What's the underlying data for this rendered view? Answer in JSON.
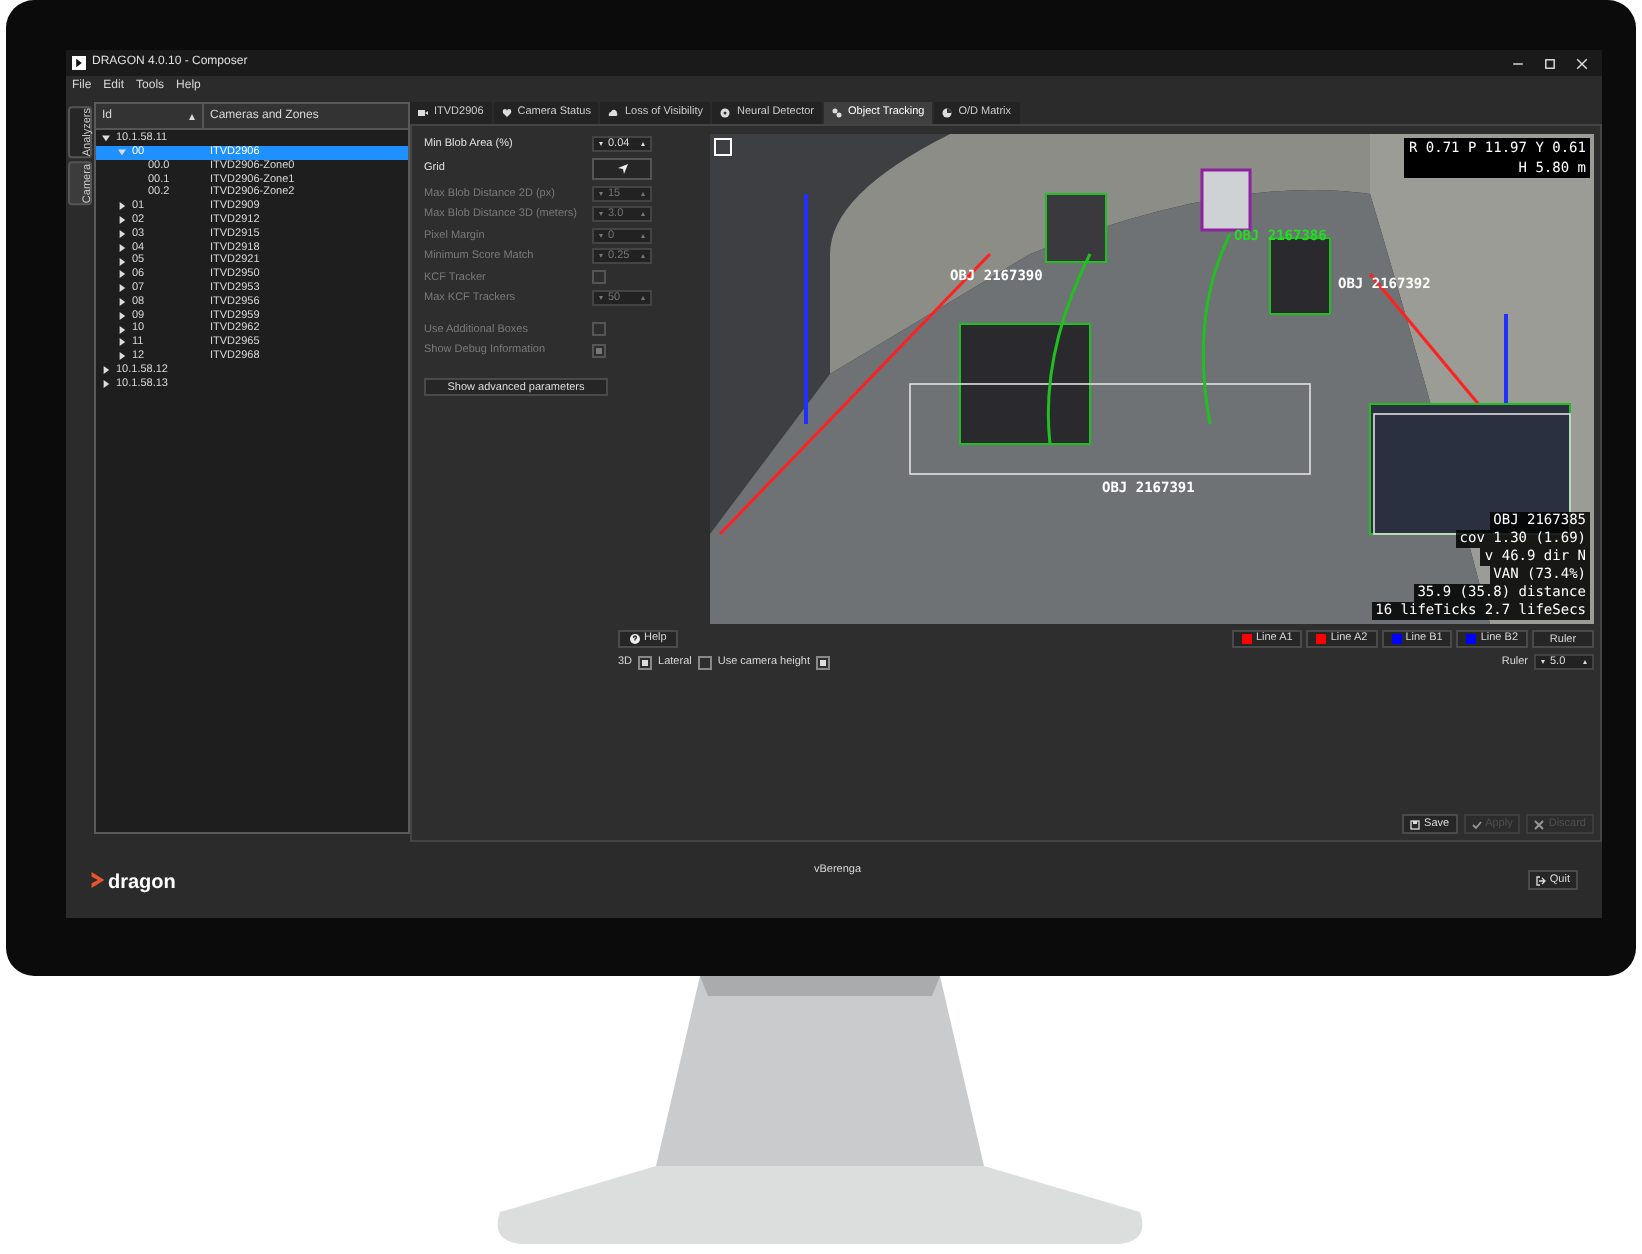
{
  "window": {
    "title": "DRAGON 4.0.10 - Composer"
  },
  "menu": [
    "File",
    "Edit",
    "Tools",
    "Help"
  ],
  "side_tabs": [
    {
      "label": "Analyzers",
      "selected": false
    },
    {
      "label": "Camera",
      "selected": true
    }
  ],
  "tree": {
    "columns": [
      "Id",
      "Cameras and Zones"
    ],
    "items": [
      {
        "id": "10.1.58.11",
        "expanded": true,
        "selected": false,
        "children": [
          {
            "id": "00",
            "name": "ITVD2906",
            "expanded": true,
            "selected": true,
            "children": [
              {
                "id": "00.0",
                "name": "ITVD2906-Zone0",
                "selected": false
              },
              {
                "id": "00.1",
                "name": "ITVD2906-Zone1",
                "selected": false
              },
              {
                "id": "00.2",
                "name": "ITVD2906-Zone2",
                "selected": false
              }
            ]
          },
          {
            "id": "01",
            "name": "ITVD2909",
            "expanded": false,
            "selected": false
          },
          {
            "id": "02",
            "name": "ITVD2912",
            "expanded": false,
            "selected": false
          },
          {
            "id": "03",
            "name": "ITVD2915",
            "expanded": false,
            "selected": false
          },
          {
            "id": "04",
            "name": "ITVD2918",
            "expanded": false,
            "selected": false
          },
          {
            "id": "05",
            "name": "ITVD2921",
            "expanded": false,
            "selected": false
          },
          {
            "id": "06",
            "name": "ITVD2950",
            "expanded": false,
            "selected": false
          },
          {
            "id": "07",
            "name": "ITVD2953",
            "expanded": false,
            "selected": false
          },
          {
            "id": "08",
            "name": "ITVD2956",
            "expanded": false,
            "selected": false
          },
          {
            "id": "09",
            "name": "ITVD2959",
            "expanded": false,
            "selected": false
          },
          {
            "id": "10",
            "name": "ITVD2962",
            "expanded": false,
            "selected": false
          },
          {
            "id": "11",
            "name": "ITVD2965",
            "expanded": false,
            "selected": false
          },
          {
            "id": "12",
            "name": "ITVD2968",
            "expanded": false,
            "selected": false
          }
        ]
      },
      {
        "id": "10.1.58.12",
        "expanded": false,
        "selected": false
      },
      {
        "id": "10.1.58.13",
        "expanded": false,
        "selected": false
      }
    ]
  },
  "tabs": [
    {
      "label": "ITVD2906",
      "selected": false
    },
    {
      "label": "Camera Status",
      "selected": false
    },
    {
      "label": "Loss of Visibility",
      "selected": false
    },
    {
      "label": "Neural Detector",
      "selected": false
    },
    {
      "label": "Object Tracking",
      "selected": true
    },
    {
      "label": "O/D Matrix",
      "selected": false
    }
  ],
  "parameters": [
    {
      "kind": "spin",
      "label": "Min Blob Area (%)",
      "value": "0.04",
      "disabled": false
    },
    {
      "kind": "button",
      "label": "Grid",
      "disabled": false
    },
    {
      "kind": "spin",
      "label": "Max Blob Distance 2D (px)",
      "value": "15",
      "disabled": true
    },
    {
      "kind": "spin",
      "label": "Max Blob Distance 3D (meters)",
      "value": "3.0",
      "disabled": true
    },
    {
      "kind": "spin",
      "label": "Pixel Margin",
      "value": "0",
      "disabled": true
    },
    {
      "kind": "spin",
      "label": "Minimum Score Match",
      "value": "0.25",
      "disabled": true
    },
    {
      "kind": "checkbox",
      "label": "KCF Tracker",
      "checked": false,
      "disabled": true
    },
    {
      "kind": "spin",
      "label": "Max KCF Trackers",
      "value": "50",
      "disabled": true
    },
    {
      "kind": "checkbox",
      "label": "Use Additional Boxes",
      "checked": false,
      "disabled": true
    },
    {
      "kind": "checkbox",
      "label": "Show Debug Information",
      "checked": true,
      "disabled": true
    }
  ],
  "advanced_button": "Show advanced parameters",
  "video": {
    "readout": [
      "R 0.71 P 11.97 Y 0.61",
      "H 5.80 m"
    ],
    "objects": [
      {
        "label": "OBJ 2167390",
        "color": "#ffffff"
      },
      {
        "label": "OBJ 2167386",
        "color": "#22dd22"
      },
      {
        "label": "OBJ 2167392",
        "color": "#ffffff"
      },
      {
        "label": "OBJ 2167391",
        "color": "#ffffff"
      }
    ],
    "info": [
      "OBJ 2167385",
      "cov 1.30 (1.69)",
      "v 46.9 dir N",
      "VAN (73.4%)",
      "35.9 (35.8) distance",
      "16 lifeTicks 2.7 lifeSecs"
    ]
  },
  "help_button": "Help",
  "line_buttons": [
    {
      "label": "Line A1",
      "color": "#ff0000"
    },
    {
      "label": "Line A2",
      "color": "#ff0000"
    },
    {
      "label": "Line B1",
      "color": "#0000ff"
    },
    {
      "label": "Line B2",
      "color": "#0000ff"
    }
  ],
  "ruler_button": "Ruler",
  "options": [
    {
      "label": "3D",
      "checked": true
    },
    {
      "label": "Lateral",
      "checked": false
    },
    {
      "label": "Use camera height",
      "checked": true
    }
  ],
  "ruler": {
    "label": "Ruler",
    "value": "5.0"
  },
  "actions": [
    {
      "label": "Save",
      "disabled": false
    },
    {
      "label": "Apply",
      "disabled": true
    },
    {
      "label": "Discard",
      "disabled": true
    }
  ],
  "footer": {
    "logo": "dragon",
    "user": "vBerenga",
    "quit": "Quit"
  }
}
